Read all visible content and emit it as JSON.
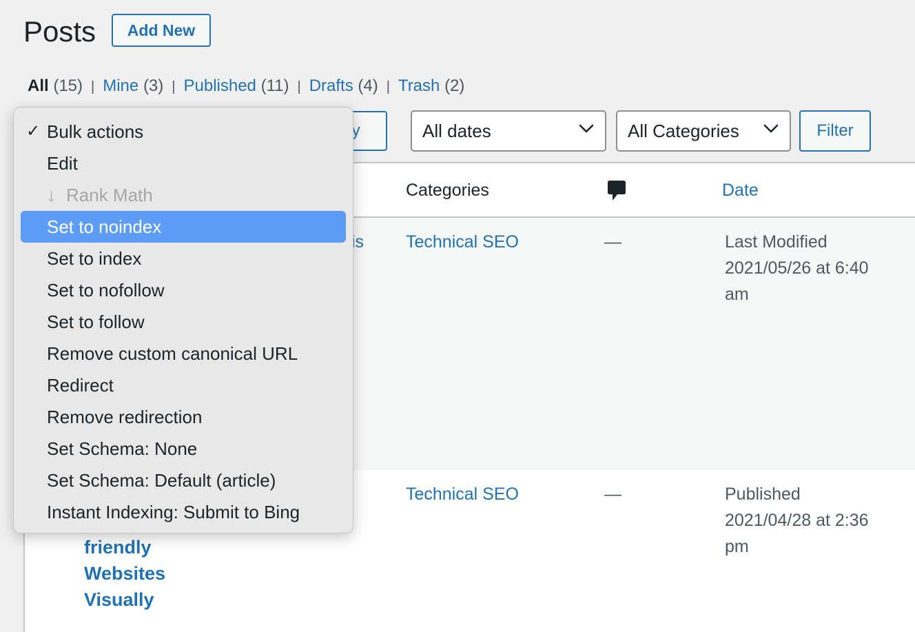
{
  "header": {
    "title": "Posts",
    "add_new": "Add New"
  },
  "filters": [
    {
      "label": "All",
      "count": "(15)",
      "current": true
    },
    {
      "label": "Mine",
      "count": "(3)"
    },
    {
      "label": "Published",
      "count": "(11)"
    },
    {
      "label": "Drafts",
      "count": "(4)"
    },
    {
      "label": "Trash",
      "count": "(2)"
    }
  ],
  "tablenav": {
    "apply_partial": "ply",
    "dates_select": "All dates",
    "categories_select": "All Categories",
    "filter_button": "Filter"
  },
  "table": {
    "headers": {
      "categories": "Categories",
      "comments_icon": "comment-icon",
      "date": "Date"
    },
    "rows": [
      {
        "title_fragment": "is",
        "category": "Technical SEO",
        "comments": "—",
        "date_status": "Last Modified",
        "date_value": "2021/05/26 at 6:40",
        "date_ampm": "am"
      },
      {
        "title_lines": [
          "friendly",
          "Websites",
          "Visually"
        ],
        "category": "Technical SEO",
        "comments": "—",
        "date_status": "Published",
        "date_value": "2021/04/28 at 2:36",
        "date_ampm": "pm"
      }
    ]
  },
  "bulk_menu": {
    "checkmark": "✓",
    "items": [
      {
        "label": "Bulk actions",
        "checked": true
      },
      {
        "label": "Edit"
      },
      {
        "label": "Rank Math",
        "disabled": true,
        "prefix": "↓"
      },
      {
        "label": "Set to noindex",
        "highlighted": true
      },
      {
        "label": "Set to index"
      },
      {
        "label": "Set to nofollow"
      },
      {
        "label": "Set to follow"
      },
      {
        "label": "Remove custom canonical URL"
      },
      {
        "label": "Redirect"
      },
      {
        "label": "Remove redirection"
      },
      {
        "label": "Set Schema: None"
      },
      {
        "label": "Set Schema: Default (article)"
      },
      {
        "label": "Instant Indexing: Submit to Bing"
      }
    ]
  },
  "colors": {
    "link": "#2271b1",
    "highlight": "#5d9df7",
    "background": "#f0f0f1"
  }
}
